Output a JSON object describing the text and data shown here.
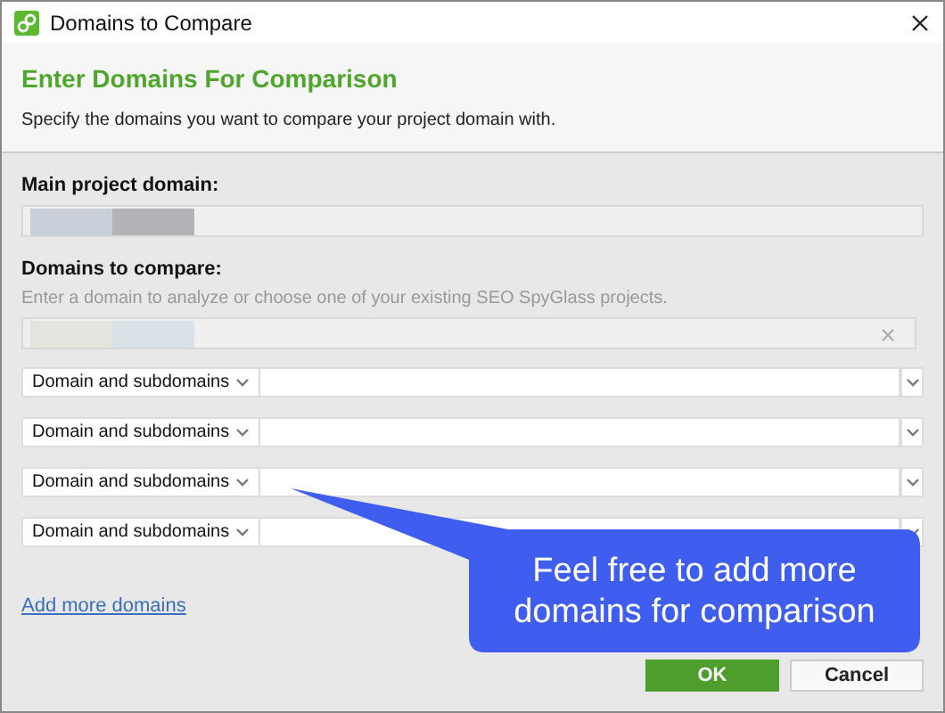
{
  "window": {
    "title": "Domains to Compare"
  },
  "header": {
    "title": "Enter Domains For Comparison",
    "subtitle": "Specify the domains you want to compare your project domain with."
  },
  "main_domain": {
    "label": "Main project domain:"
  },
  "compare": {
    "label": "Domains to compare:",
    "hint": "Enter a domain to analyze or choose one of your existing SEO SpyGlass projects."
  },
  "rows": [
    {
      "scope": "Domain and subdomains"
    },
    {
      "scope": "Domain and subdomains"
    },
    {
      "scope": "Domain and subdomains"
    },
    {
      "scope": "Domain and subdomains"
    }
  ],
  "add_link": "Add more domains",
  "callout": {
    "text": "Feel free to add more domains for comparison"
  },
  "buttons": [
    {
      "label": "OK",
      "kind": "primary"
    },
    {
      "label": "Cancel",
      "kind": "secondary"
    }
  ]
}
